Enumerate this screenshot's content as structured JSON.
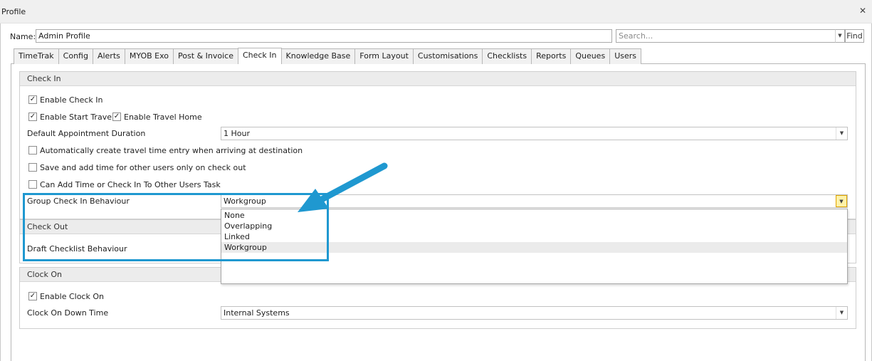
{
  "window": {
    "title": "Profile",
    "close_icon": "close-icon"
  },
  "name_label": "Name:",
  "name_value": "Admin Profile",
  "search_placeholder": "Search...",
  "find_label": "Find",
  "tabs": [
    "TimeTrak",
    "Config",
    "Alerts",
    "MYOB Exo",
    "Post & Invoice",
    "Check In",
    "Knowledge Base",
    "Form Layout",
    "Customisations",
    "Checklists",
    "Reports",
    "Queues",
    "Users"
  ],
  "active_tab": "Check In",
  "check_in": {
    "header": "Check In",
    "enable_check_in": "Enable Check In",
    "enable_start_travel": "Enable Start Travel",
    "enable_travel_home": "Enable Travel Home",
    "default_duration_label": "Default Appointment Duration",
    "default_duration_value": "1 Hour",
    "auto_travel": "Automatically create travel time entry when arriving at destination",
    "save_add_time": "Save and add time for other users only on check out",
    "can_add_time": "Can Add Time or Check In To Other Users Task",
    "group_behaviour_label": "Group Check In Behaviour",
    "group_behaviour_value": "Workgroup",
    "group_behaviour_options": [
      "None",
      "Overlapping",
      "Linked",
      "Workgroup"
    ]
  },
  "check_out": {
    "header": "Check Out",
    "draft_checklist_label": "Draft Checklist Behaviour"
  },
  "clock_on": {
    "header": "Clock On",
    "enable_clock_on": "Enable Clock On",
    "down_time_label": "Clock On Down Time",
    "down_time_value": "Internal Systems"
  },
  "accent_color": "#1f98d0"
}
